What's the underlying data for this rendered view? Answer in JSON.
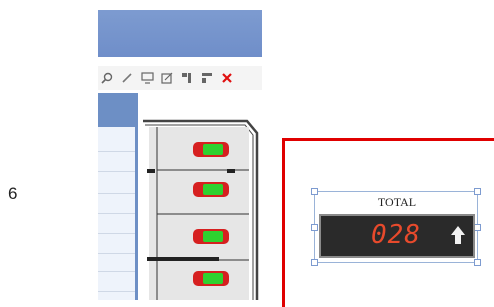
{
  "step_label": "6",
  "toolbar": {
    "icons": [
      "search-icon",
      "pencil-icon",
      "monitor-icon",
      "edit-icon",
      "align-icon",
      "layout-icon",
      "delete-icon"
    ]
  },
  "parking_lot": {
    "car_colors": {
      "body": "#d62020",
      "roof": "#2fd12f"
    },
    "car_count": 4
  },
  "counter": {
    "title": "TOTAL",
    "value": "028",
    "direction_icon": "up-arrow-icon",
    "digit_color": "#e84a2c",
    "frame_color": "#e00000"
  }
}
